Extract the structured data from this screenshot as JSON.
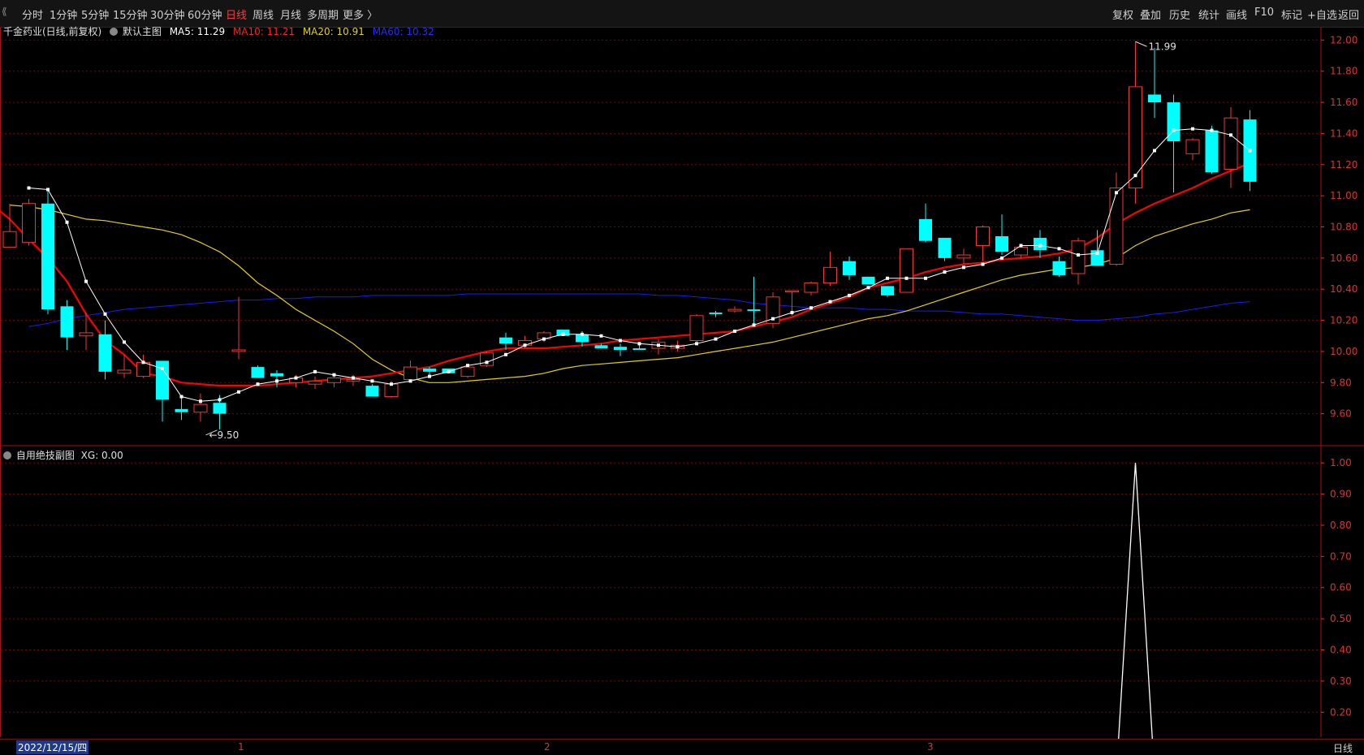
{
  "toolbar": {
    "left": [
      "分时",
      "1分钟",
      "5分钟",
      "15分钟",
      "30分钟",
      "60分钟",
      "日线",
      "周线",
      "月线",
      "多周期",
      "更多 〉"
    ],
    "active": "日线",
    "right": [
      "复权",
      "叠加",
      "历史",
      "统计",
      "画线",
      "F10",
      "标记",
      "+自选",
      "返回"
    ]
  },
  "main_legend": {
    "title": "千金药业(日线,前复权)",
    "template": "默认主图",
    "ma5": "MA5: 11.29",
    "ma10": "MA10: 11.21",
    "ma20": "MA20: 10.91",
    "ma60": "MA60: 10.32"
  },
  "sub_legend": {
    "title": "自用绝技副图",
    "xg": "XG: 0.00"
  },
  "annotations": {
    "high": "11.99",
    "low": "9.50"
  },
  "bottom": {
    "date": "2022/12/15/四",
    "months": [
      "1",
      "2",
      "3"
    ],
    "period": "日线"
  },
  "colors": {
    "up": "#ff3030",
    "down": "#00ffff",
    "ma5": "#ffffff",
    "ma10": "#ff0000",
    "ma20": "#e6d200",
    "ma60": "#1a1aff",
    "grid": "#7a0000",
    "axis": "#e03030"
  },
  "chart_data": [
    {
      "type": "candlestick",
      "title": "千金药业(日线,前复权)",
      "ylim": [
        9.4,
        12.08
      ],
      "yticks": [
        "12.00",
        "11.80",
        "11.60",
        "11.40",
        "11.20",
        "11.00",
        "10.80",
        "10.60",
        "10.40",
        "10.20",
        "10.00",
        "9.80",
        "9.60"
      ],
      "candles": [
        {
          "o": 10.67,
          "h": 10.95,
          "l": 10.67,
          "c": 10.77
        },
        {
          "o": 10.7,
          "h": 10.98,
          "l": 10.68,
          "c": 10.95
        },
        {
          "o": 10.95,
          "h": 11.03,
          "l": 10.24,
          "c": 10.27
        },
        {
          "o": 10.29,
          "h": 10.33,
          "l": 10.01,
          "c": 10.09
        },
        {
          "o": 10.1,
          "h": 10.25,
          "l": 10.01,
          "c": 10.12
        },
        {
          "o": 10.11,
          "h": 10.2,
          "l": 9.82,
          "c": 9.87
        },
        {
          "o": 9.86,
          "h": 9.98,
          "l": 9.83,
          "c": 9.88
        },
        {
          "o": 9.84,
          "h": 9.98,
          "l": 9.83,
          "c": 9.93
        },
        {
          "o": 9.94,
          "h": 9.94,
          "l": 9.55,
          "c": 9.69
        },
        {
          "o": 9.63,
          "h": 9.71,
          "l": 9.56,
          "c": 9.61
        },
        {
          "o": 9.61,
          "h": 9.73,
          "l": 9.55,
          "c": 9.66
        },
        {
          "o": 9.67,
          "h": 9.72,
          "l": 9.5,
          "c": 9.6
        },
        {
          "o": 10.0,
          "h": 10.35,
          "l": 9.95,
          "c": 10.01
        },
        {
          "o": 9.9,
          "h": 9.91,
          "l": 9.83,
          "c": 9.83
        },
        {
          "o": 9.86,
          "h": 9.88,
          "l": 9.77,
          "c": 9.84
        },
        {
          "o": 9.8,
          "h": 9.85,
          "l": 9.77,
          "c": 9.83
        },
        {
          "o": 9.79,
          "h": 9.84,
          "l": 9.76,
          "c": 9.81
        },
        {
          "o": 9.8,
          "h": 9.85,
          "l": 9.77,
          "c": 9.83
        },
        {
          "o": 9.81,
          "h": 9.85,
          "l": 9.78,
          "c": 9.82
        },
        {
          "o": 9.78,
          "h": 9.79,
          "l": 9.71,
          "c": 9.71
        },
        {
          "o": 9.71,
          "h": 9.81,
          "l": 9.7,
          "c": 9.79
        },
        {
          "o": 9.82,
          "h": 9.94,
          "l": 9.81,
          "c": 9.9
        },
        {
          "o": 9.89,
          "h": 9.9,
          "l": 9.85,
          "c": 9.87
        },
        {
          "o": 9.89,
          "h": 9.89,
          "l": 9.86,
          "c": 9.86
        },
        {
          "o": 9.84,
          "h": 9.91,
          "l": 9.83,
          "c": 9.9
        },
        {
          "o": 9.91,
          "h": 10.0,
          "l": 9.9,
          "c": 9.99
        },
        {
          "o": 10.09,
          "h": 10.12,
          "l": 10.01,
          "c": 10.05
        },
        {
          "o": 10.04,
          "h": 10.1,
          "l": 10.02,
          "c": 10.07
        },
        {
          "o": 10.08,
          "h": 10.13,
          "l": 10.06,
          "c": 10.12
        },
        {
          "o": 10.14,
          "h": 10.14,
          "l": 10.1,
          "c": 10.1
        },
        {
          "o": 10.11,
          "h": 10.13,
          "l": 10.03,
          "c": 10.06
        },
        {
          "o": 10.04,
          "h": 10.05,
          "l": 10.02,
          "c": 10.02
        },
        {
          "o": 10.03,
          "h": 10.05,
          "l": 9.97,
          "c": 10.01
        },
        {
          "o": 10.02,
          "h": 10.05,
          "l": 10.01,
          "c": 10.01
        },
        {
          "o": 10.02,
          "h": 10.08,
          "l": 9.98,
          "c": 10.06
        },
        {
          "o": 10.02,
          "h": 10.07,
          "l": 10.0,
          "c": 10.04
        },
        {
          "o": 10.07,
          "h": 10.24,
          "l": 10.06,
          "c": 10.23
        },
        {
          "o": 10.25,
          "h": 10.26,
          "l": 10.22,
          "c": 10.24
        },
        {
          "o": 10.26,
          "h": 10.29,
          "l": 10.25,
          "c": 10.27
        },
        {
          "o": 10.27,
          "h": 10.48,
          "l": 10.16,
          "c": 10.26
        },
        {
          "o": 10.18,
          "h": 10.38,
          "l": 10.15,
          "c": 10.35
        },
        {
          "o": 10.39,
          "h": 10.39,
          "l": 10.23,
          "c": 10.39
        },
        {
          "o": 10.38,
          "h": 10.45,
          "l": 10.36,
          "c": 10.44
        },
        {
          "o": 10.44,
          "h": 10.64,
          "l": 10.42,
          "c": 10.54
        },
        {
          "o": 10.58,
          "h": 10.61,
          "l": 10.46,
          "c": 10.49
        },
        {
          "o": 10.48,
          "h": 10.48,
          "l": 10.43,
          "c": 10.43
        },
        {
          "o": 10.42,
          "h": 10.42,
          "l": 10.35,
          "c": 10.36
        },
        {
          "o": 10.38,
          "h": 10.66,
          "l": 10.38,
          "c": 10.66
        },
        {
          "o": 10.85,
          "h": 10.95,
          "l": 10.7,
          "c": 10.71
        },
        {
          "o": 10.73,
          "h": 10.73,
          "l": 10.58,
          "c": 10.6
        },
        {
          "o": 10.6,
          "h": 10.66,
          "l": 10.56,
          "c": 10.62
        },
        {
          "o": 10.68,
          "h": 10.81,
          "l": 10.58,
          "c": 10.8
        },
        {
          "o": 10.74,
          "h": 10.88,
          "l": 10.62,
          "c": 10.64
        },
        {
          "o": 10.62,
          "h": 10.69,
          "l": 10.6,
          "c": 10.67
        },
        {
          "o": 10.73,
          "h": 10.78,
          "l": 10.6,
          "c": 10.65
        },
        {
          "o": 10.58,
          "h": 10.61,
          "l": 10.48,
          "c": 10.49
        },
        {
          "o": 10.5,
          "h": 10.73,
          "l": 10.43,
          "c": 10.71
        },
        {
          "o": 10.65,
          "h": 10.78,
          "l": 10.55,
          "c": 10.55
        },
        {
          "o": 10.56,
          "h": 11.15,
          "l": 10.55,
          "c": 11.05
        },
        {
          "o": 11.05,
          "h": 11.99,
          "l": 10.95,
          "c": 11.7
        },
        {
          "o": 11.65,
          "h": 11.95,
          "l": 11.5,
          "c": 11.6
        },
        {
          "o": 11.6,
          "h": 11.65,
          "l": 11.02,
          "c": 11.35
        },
        {
          "o": 11.27,
          "h": 11.37,
          "l": 11.23,
          "c": 11.36
        },
        {
          "o": 11.42,
          "h": 11.45,
          "l": 11.14,
          "c": 11.15
        },
        {
          "o": 11.17,
          "h": 11.57,
          "l": 11.05,
          "c": 11.5
        },
        {
          "o": 11.49,
          "h": 11.55,
          "l": 11.03,
          "c": 11.09
        }
      ],
      "ma5": [
        11.05,
        11.04,
        10.83,
        10.45,
        10.24,
        10.06,
        9.93,
        9.89,
        9.71,
        9.68,
        9.69,
        9.74,
        9.79,
        9.81,
        9.83,
        9.87,
        9.85,
        9.83,
        9.81,
        9.79,
        9.81,
        9.84,
        9.87,
        9.91,
        9.93,
        9.98,
        10.04,
        10.08,
        10.11,
        10.11,
        10.1,
        10.07,
        10.05,
        10.04,
        10.03,
        10.05,
        10.08,
        10.13,
        10.17,
        10.21,
        10.25,
        10.28,
        10.32,
        10.36,
        10.41,
        10.47,
        10.47,
        10.47,
        10.51,
        10.54,
        10.56,
        10.6,
        10.68,
        10.68,
        10.66,
        10.62,
        10.63,
        11.02,
        11.13,
        11.29,
        11.42,
        11.43,
        11.42,
        11.39,
        11.29
      ],
      "ma10": [
        11.0,
        11.0,
        10.95,
        10.85,
        10.72,
        10.6,
        10.45,
        10.24,
        10.07,
        9.98,
        9.86,
        9.84,
        9.8,
        9.79,
        9.78,
        9.78,
        9.78,
        9.79,
        9.8,
        9.81,
        9.82,
        9.83,
        9.84,
        9.86,
        9.88,
        9.9,
        9.94,
        9.97,
        10.0,
        10.02,
        10.02,
        10.02,
        10.03,
        10.04,
        10.05,
        10.07,
        10.08,
        10.09,
        10.1,
        10.11,
        10.12,
        10.13,
        10.16,
        10.19,
        10.22,
        10.27,
        10.31,
        10.35,
        10.41,
        10.44,
        10.47,
        10.51,
        10.54,
        10.56,
        10.57,
        10.59,
        10.6,
        10.61,
        10.63,
        10.66,
        10.73,
        10.82,
        10.89,
        10.95,
        11.0,
        11.05,
        11.11,
        11.16,
        11.21
      ],
      "ma20": [
        10.94,
        10.93,
        10.91,
        10.88,
        10.85,
        10.84,
        10.82,
        10.8,
        10.78,
        10.75,
        10.7,
        10.64,
        10.55,
        10.44,
        10.36,
        10.27,
        10.2,
        10.13,
        10.05,
        9.95,
        9.88,
        9.83,
        9.8,
        9.8,
        9.81,
        9.82,
        9.83,
        9.84,
        9.86,
        9.89,
        9.91,
        9.92,
        9.93,
        9.94,
        9.95,
        9.96,
        9.98,
        10.0,
        10.02,
        10.04,
        10.06,
        10.09,
        10.12,
        10.15,
        10.18,
        10.21,
        10.23,
        10.26,
        10.3,
        10.34,
        10.38,
        10.42,
        10.46,
        10.49,
        10.51,
        10.53,
        10.54,
        10.56,
        10.6,
        10.68,
        10.74,
        10.78,
        10.82,
        10.85,
        10.89,
        10.91
      ],
      "ma60": [
        10.16,
        10.18,
        10.21,
        10.23,
        10.25,
        10.27,
        10.28,
        10.29,
        10.3,
        10.31,
        10.32,
        10.33,
        10.33,
        10.34,
        10.34,
        10.35,
        10.35,
        10.35,
        10.36,
        10.36,
        10.36,
        10.36,
        10.36,
        10.37,
        10.37,
        10.37,
        10.37,
        10.37,
        10.37,
        10.37,
        10.37,
        10.37,
        10.37,
        10.36,
        10.36,
        10.35,
        10.34,
        10.33,
        10.31,
        10.3,
        10.29,
        10.28,
        10.28,
        10.28,
        10.27,
        10.27,
        10.26,
        10.26,
        10.26,
        10.25,
        10.24,
        10.24,
        10.23,
        10.22,
        10.21,
        10.2,
        10.2,
        10.21,
        10.22,
        10.24,
        10.25,
        10.27,
        10.29,
        10.31,
        10.32
      ]
    },
    {
      "type": "line",
      "title": "自用绝技副图",
      "ylim": [
        0.12,
        1.05
      ],
      "yticks": [
        "1.00",
        "0.90",
        "0.80",
        "0.70",
        "0.60",
        "0.50",
        "0.40",
        "0.30",
        "0.20"
      ],
      "series": [
        {
          "name": "XG",
          "values": [
            0,
            0,
            0,
            0,
            0,
            0,
            0,
            0,
            0,
            0,
            0,
            0,
            0,
            0,
            0,
            0,
            0,
            0,
            0,
            0,
            0,
            0,
            0,
            0,
            0,
            0,
            0,
            0,
            0,
            0,
            0,
            0,
            0,
            0,
            0,
            0,
            0,
            0,
            0,
            0,
            0,
            0,
            0,
            0,
            0,
            0,
            0,
            0,
            0,
            0,
            0,
            0,
            0,
            0,
            0,
            0,
            0,
            0,
            0,
            1,
            0,
            0,
            0,
            0,
            0,
            0,
            0
          ]
        }
      ]
    }
  ]
}
